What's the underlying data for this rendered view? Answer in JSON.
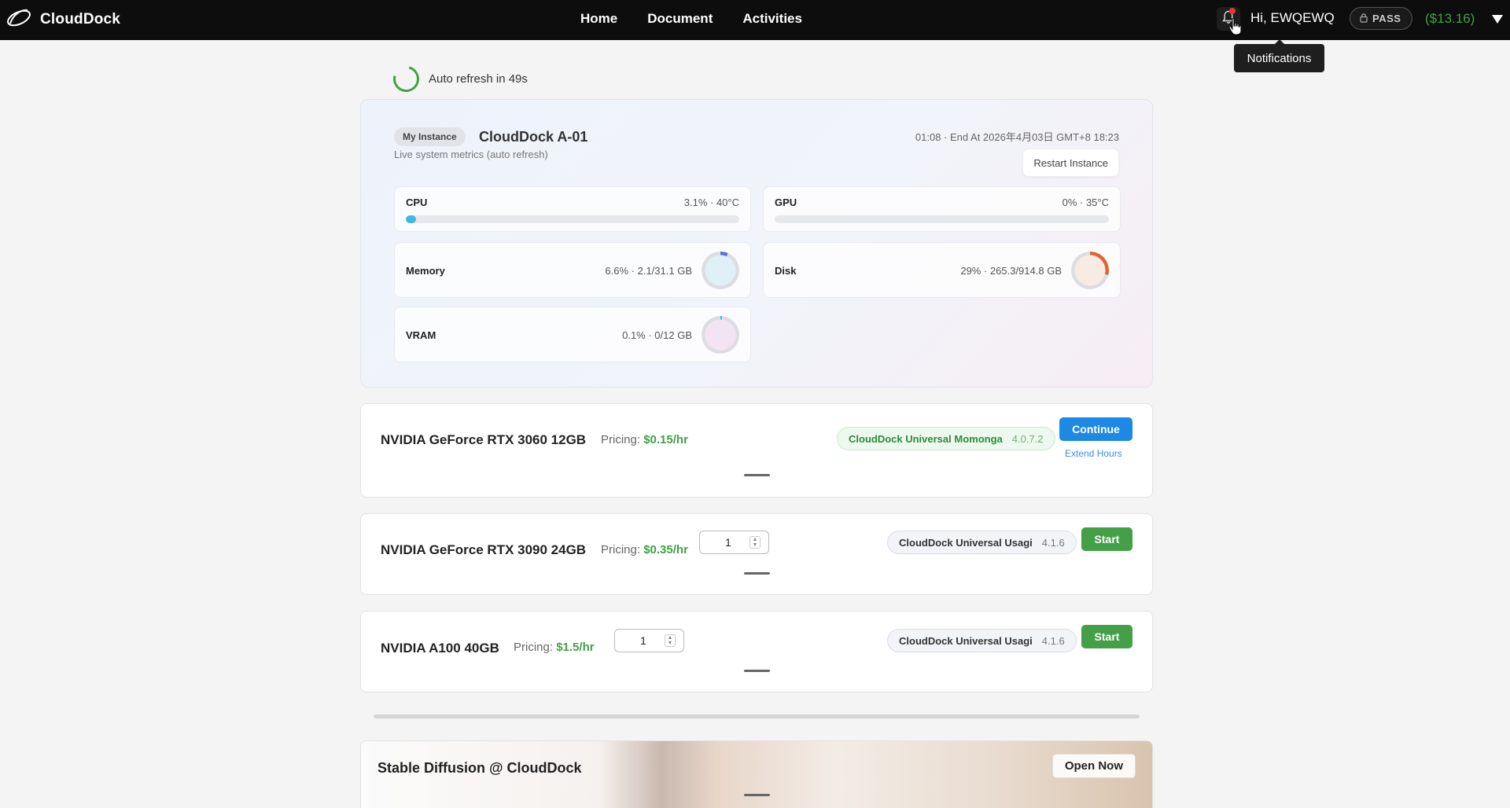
{
  "header": {
    "brand": "CloudDock",
    "nav": [
      "Home",
      "Document",
      "Activities"
    ],
    "greeting": "Hi, EWQEWQ",
    "pass_label": "PASS",
    "balance": "($13.16)",
    "tooltip": "Notifications"
  },
  "refresh": {
    "label": "Auto refresh in 49s"
  },
  "instance": {
    "badge": "My Instance",
    "name": "CloudDock A-01",
    "subtitle": "Live system metrics (auto refresh)",
    "time": "01:08 · End At 2026年4月03日 GMT+8 18:23",
    "restart_label": "Restart Instance",
    "metrics": {
      "cpu": {
        "label": "CPU",
        "value": "3.1% · 40°C",
        "percent": 3.1
      },
      "gpu": {
        "label": "GPU",
        "value": "0% · 35°C",
        "percent": 0
      },
      "memory": {
        "label": "Memory",
        "value": "6.6% · 2.1/31.1 GB",
        "percent": 6.6,
        "color": "#5b6ee1"
      },
      "disk": {
        "label": "Disk",
        "value": "29% · 265.3/914.8 GB",
        "percent": 29,
        "color": "#e8602c"
      },
      "vram": {
        "label": "VRAM",
        "value": "0.1% · 0/12 GB",
        "percent": 0.1,
        "color": "#3bb9e6"
      }
    }
  },
  "gpus": [
    {
      "name": "NVIDIA GeForce RTX 3060 12GB",
      "pricing_label": "Pricing:",
      "price": "$0.15/hr",
      "image": "CloudDock Universal Momonga",
      "version": "4.0.7.2",
      "action": "Continue",
      "extend": "Extend Hours"
    },
    {
      "name": "NVIDIA GeForce RTX 3090 24GB",
      "pricing_label": "Pricing:",
      "price": "$0.35/hr",
      "qty": "1",
      "image": "CloudDock Universal Usagi",
      "version": "4.1.6",
      "action": "Start"
    },
    {
      "name": "NVIDIA A100 40GB",
      "pricing_label": "Pricing:",
      "price": "$1.5/hr",
      "qty": "1",
      "image": "CloudDock Universal Usagi",
      "version": "4.1.6",
      "action": "Start"
    }
  ],
  "banner": {
    "title": "Stable Diffusion @ CloudDock",
    "button": "Open Now"
  }
}
